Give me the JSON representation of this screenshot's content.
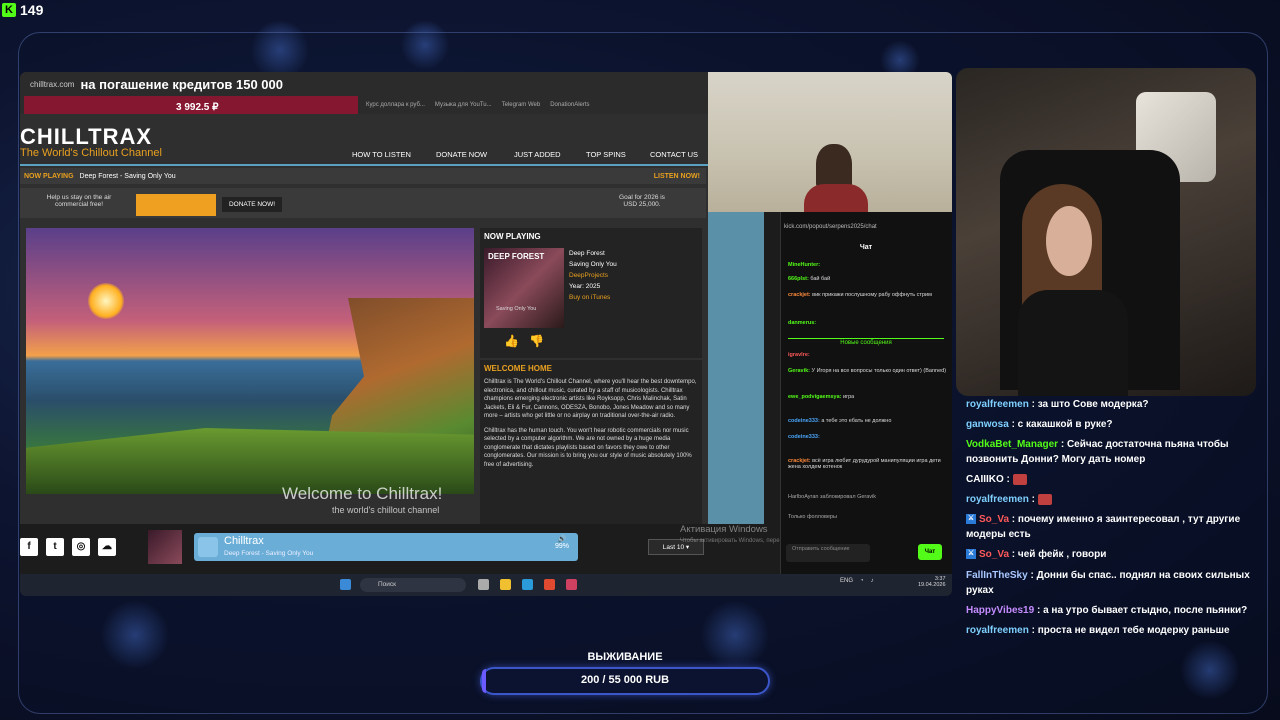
{
  "top": {
    "count": "149",
    "logo_letter": "K"
  },
  "browser": {
    "url": "chilltrax.com",
    "overlay_text": "на погашение кредитов 150 000",
    "red_amount": "3 992.5 ₽",
    "bookmarks": [
      "Курс доллара к руб...",
      "Музыка для YouTu...",
      "Telegram Web",
      "DonationAlerts"
    ]
  },
  "site": {
    "logo": "CHILLTRAX",
    "tagline": "The World's Chillout Channel",
    "nav": [
      "HOW TO LISTEN",
      "DONATE NOW",
      "JUST ADDED",
      "TOP SPINS",
      "CONTACT US"
    ],
    "now_playing_label": "NOW PLAYING",
    "now_playing_track": "Deep Forest - Saving Only You",
    "listen_now": "LISTEN NOW!",
    "help_text": "Help us stay on the air commercial free!",
    "donate_button": "DONATE NOW!",
    "goal_text": "Goal for 2026 is USD 25,000.",
    "hero_title": "Welcome to Chilltrax!",
    "hero_sub": "the world's chillout channel",
    "np_title": "NOW PLAYING",
    "cover_title": "DEEP FOREST",
    "cover_sub": "Saving Only You",
    "track_artist": "Deep Forest",
    "track_title": "Saving Only You",
    "track_label": "DeepProjects",
    "track_year": "Year: 2025",
    "track_buy": "Buy on iTunes",
    "home_title": "WELCOME HOME",
    "home_p1": "Chilltrax is The World's Chillout Channel, where you'll hear the best downtempo, electronica, and chillout music, curated by a staff of musicologists. Chilltrax champions emerging electronic artists like Royksopp, Chris Malinchak, Satin Jackets, Eli & Fur, Cannons, ODESZA, Bonobo, Jones Meadow and so many more – artists who get little or no airplay on traditional over-the-air radio.",
    "home_p2": "Chilltrax has the human touch. You won't hear robotic commercials nor music selected by a computer algorithm. We are not owned by a huge media conglomerate that dictates playlists based on favors they owe to other conglomerates. Our mission is to bring you our style of music absolutely 100% free of advertising."
  },
  "player": {
    "title": "Chilltrax",
    "sub": "Deep Forest - Saving Only You",
    "volume": "99%",
    "last": "Last 10",
    "win_activate": "Активация Windows",
    "win_activate_sub": "Чтобы активировать Windows, перейдите в раздел \"Параметры\"."
  },
  "taskbar": {
    "search": "Поиск",
    "lang": "ENG",
    "time": "3:37",
    "date": "19.04.2026"
  },
  "popout": {
    "url": "kick.com/popout/serpens2025/chat",
    "title": "Чат",
    "new_messages": "Новые сообщения",
    "messages": [
      {
        "u": "MineHunter:",
        "t": ""
      },
      {
        "u": "666plst:",
        "t": "бай бай"
      },
      {
        "u": "crackjet:",
        "t": "вик прикажи послушному рабу оффнуть стрим"
      },
      {
        "u": "danmerus:",
        "t": ""
      },
      {
        "u": "igravlre:",
        "t": ""
      },
      {
        "u": "Geravik:",
        "t": "У Игоря на все вопросы только один ответ) (Banned)"
      },
      {
        "u": "ewe_podvigaemsya:",
        "t": "игра"
      },
      {
        "u": "codeine333:",
        "t": "а тебе это ебать не должно"
      },
      {
        "u": "codeine333:",
        "t": ""
      },
      {
        "u": "crackjet:",
        "t": "всё игра любит дурудурой манипуляции игра дети жена холдем котенок"
      },
      {
        "u": "HarlboAyran",
        "t": "заблокировал Geravik"
      }
    ],
    "followers_only": "Только фолловеры",
    "input_placeholder": "Отправить сообщение",
    "send": "Чат"
  },
  "chat": [
    {
      "user": "royalfreemen",
      "color": "#7fd0ff",
      "text": " : за што Сове модерка?",
      "emote": false,
      "badge": false
    },
    {
      "user": "ganwosa",
      "color": "#7fd0ff",
      "text": " : с какашкой в руке?",
      "emote": false,
      "badge": false
    },
    {
      "user": "VodkaBet_Manager",
      "color": "#53fc18",
      "text": " : Сейчас достаточна пьяна чтобы позвонить Донни? Могу дать номер",
      "emote": false,
      "badge": false
    },
    {
      "user": "CAIIIKO",
      "color": "#ffffff",
      "text": " : ",
      "emote": true,
      "badge": false
    },
    {
      "user": "royalfreemen",
      "color": "#7fd0ff",
      "text": " : ",
      "emote": true,
      "badge": false
    },
    {
      "user": "So_Va",
      "color": "#ff5a5a",
      "text": " : почему именно я заинтересовал , тут другие модеры есть",
      "emote": false,
      "badge": true
    },
    {
      "user": "So_Va",
      "color": "#ff5a5a",
      "text": " : чей фейк , говори",
      "emote": false,
      "badge": true
    },
    {
      "user": "FallInTheSky",
      "color": "#a9c8ff",
      "text": " : Донни бы спас.. поднял на своих сильных руках",
      "emote": false,
      "badge": false
    },
    {
      "user": "HappyVibes19",
      "color": "#c58cff",
      "text": " : а на утро бывает стыдно, после пьянки?",
      "emote": false,
      "badge": false
    },
    {
      "user": "royalfreemen",
      "color": "#7fd0ff",
      "text": " : проста не видел тебе модерку раньше",
      "emote": false,
      "badge": false
    }
  ],
  "survival": {
    "label": "ВЫЖИВАНИЕ",
    "value": "200 / 55 000 RUB",
    "progress": 0.0036
  }
}
